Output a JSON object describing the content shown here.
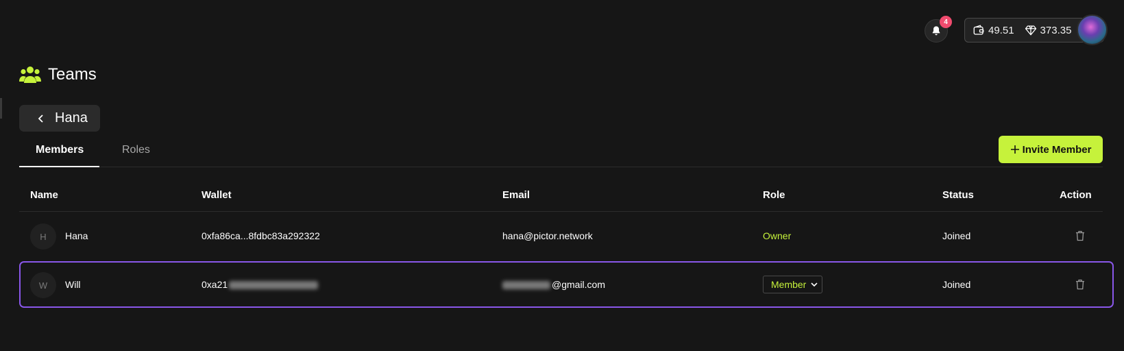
{
  "header": {
    "notification_count": "4",
    "wallet_balance": "49.51",
    "gem_balance": "373.35"
  },
  "page": {
    "title": "Teams",
    "team_name": "Hana"
  },
  "tabs": [
    {
      "label": "Members",
      "active": true
    },
    {
      "label": "Roles",
      "active": false
    }
  ],
  "invite_button_label": "Invite Member",
  "table": {
    "columns": [
      "Name",
      "Wallet",
      "Email",
      "Role",
      "Status",
      "Action"
    ],
    "rows": [
      {
        "initial": "H",
        "name": "Hana",
        "wallet": "0xfa86ca...8fdbc83a292322",
        "email": "hana@pictor.network",
        "role": "Owner",
        "status": "Joined"
      },
      {
        "initial": "W",
        "name": "Will",
        "wallet_visible": "0xa21",
        "email_visible": "@gmail.com",
        "role": "Member",
        "status": "Joined"
      }
    ]
  },
  "colors": {
    "accent": "#c6f23b",
    "selection_border": "#8a57ea",
    "badge": "#f04b6e",
    "background": "#161616"
  }
}
